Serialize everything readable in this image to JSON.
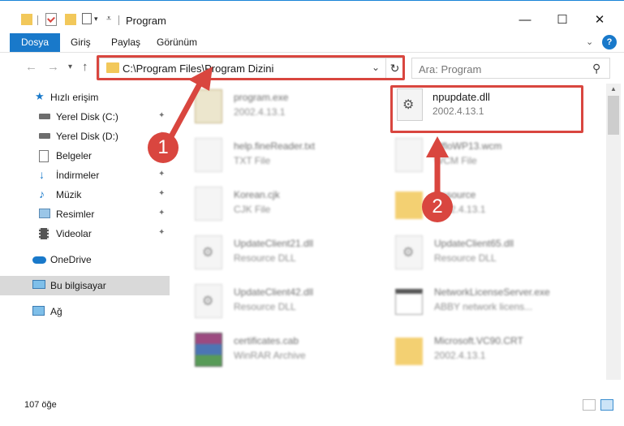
{
  "window": {
    "title": "Program",
    "minimize_glyph": "—",
    "maximize_glyph": "☐",
    "close_glyph": "✕"
  },
  "ribbon": {
    "tabs": [
      "Dosya",
      "Giriş",
      "Paylaş",
      "Görünüm"
    ],
    "help_glyph": "?"
  },
  "nav": {
    "back_glyph": "←",
    "forward_glyph": "→",
    "recent_glyph": "▾",
    "up_glyph": "↑",
    "address": "C:\\Program Files\\Program Dizini",
    "address_chevron": "⌄",
    "refresh_glyph": "↻",
    "search_placeholder": "Ara: Program",
    "search_glyph": "⚲"
  },
  "sidebar": {
    "items": [
      {
        "label": "Hızlı erişim",
        "icon": "star-icon",
        "pinned": false
      },
      {
        "label": "Yerel Disk (C:)",
        "icon": "drive-icon",
        "pinned": true
      },
      {
        "label": "Yerel Disk (D:)",
        "icon": "drive-icon",
        "pinned": true
      },
      {
        "label": "Belgeler",
        "icon": "documents-icon",
        "pinned": true
      },
      {
        "label": "İndirmeler",
        "icon": "download-icon",
        "pinned": true
      },
      {
        "label": "Müzik",
        "icon": "music-icon",
        "pinned": true
      },
      {
        "label": "Resimler",
        "icon": "pictures-icon",
        "pinned": true
      },
      {
        "label": "Videolar",
        "icon": "videos-icon",
        "pinned": true
      },
      {
        "label": "OneDrive",
        "icon": "cloud-icon",
        "pinned": false
      },
      {
        "label": "Bu bilgisayar",
        "icon": "computer-icon",
        "pinned": false
      },
      {
        "label": "Ağ",
        "icon": "network-icon",
        "pinned": false
      }
    ],
    "pin_glyph": "📌"
  },
  "files": [
    {
      "name": "program.exe",
      "sub": "2002.4.13.1",
      "icon": "exe-icon"
    },
    {
      "name": "npupdate.dll",
      "sub": "2002.4.13.1",
      "icon": "dll-gear-icon"
    },
    {
      "name": "help.fineReader.txt",
      "sub": "TXT File",
      "icon": "txt-icon"
    },
    {
      "name": "fdfloWP13.wcm",
      "sub": "WCM File",
      "icon": "file-icon"
    },
    {
      "name": "Korean.cjk",
      "sub": "CJK File",
      "icon": "file-icon"
    },
    {
      "name": "Resource",
      "sub": "2002.4.13.1",
      "icon": "folder-icon"
    },
    {
      "name": "UpdateClient21.dll",
      "sub": "Resource DLL",
      "icon": "dll-gear-icon"
    },
    {
      "name": "UpdateClient65.dll",
      "sub": "Resource DLL",
      "icon": "dll-gear-icon"
    },
    {
      "name": "UpdateClient42.dll",
      "sub": "Resource DLL",
      "icon": "dll-gear-icon"
    },
    {
      "name": "NetworkLicenseServer.exe",
      "sub": "ABBY network licens...",
      "icon": "exe-window-icon"
    },
    {
      "name": "certificates.cab",
      "sub": "WinRAR Archive",
      "icon": "winrar-icon"
    },
    {
      "name": "Microsoft.VC90.CRT",
      "sub": "2002.4.13.1",
      "icon": "folder-icon"
    }
  ],
  "status": {
    "item_count": "107 öğe"
  },
  "callouts": [
    "1",
    "2"
  ],
  "colors": {
    "accent": "#1979ca",
    "highlight_red": "#d9463f",
    "selected_bg": "#d9d9d9"
  }
}
